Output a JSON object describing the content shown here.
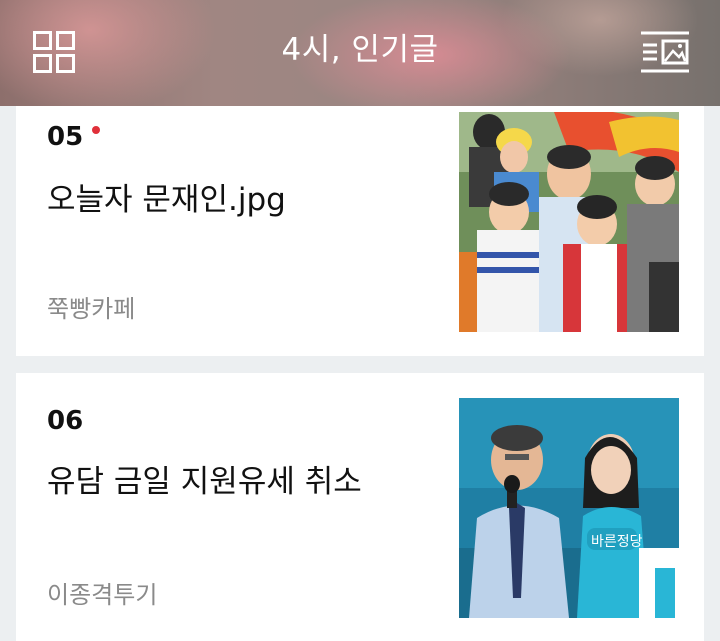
{
  "header": {
    "title": "4시, 인기글",
    "menu_icon": "grid-icon",
    "feed_icon": "list-image-icon"
  },
  "posts": [
    {
      "rank": "05",
      "is_new": true,
      "title": "오늘자 문재인.jpg",
      "source": "쭉빵카페",
      "thumbnail": "photo-crowd-children"
    },
    {
      "rank": "06",
      "is_new": false,
      "title": "유담 금일 지원유세 취소",
      "source": "이종격투기",
      "thumbnail": "photo-campaign-speech"
    }
  ],
  "colors": {
    "new_dot": "#e0303a",
    "background": "#eceff1"
  }
}
